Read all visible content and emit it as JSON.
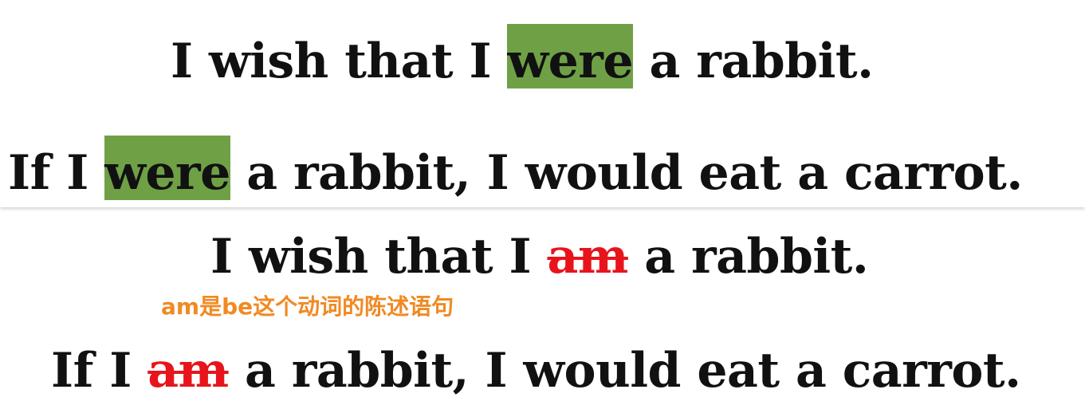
{
  "colors": {
    "highlight": "#6fa046",
    "strike": "#e8141c",
    "note": "#f08a24",
    "text": "#111111"
  },
  "top_panel": {
    "sentence1": {
      "before": "I wish that I ",
      "highlight": "were",
      "after": " a rabbit."
    },
    "sentence2": {
      "before": "If I ",
      "highlight": "were",
      "after": " a rabbit, I would eat a carrot."
    }
  },
  "bottom_panel": {
    "sentence1": {
      "before": "I wish that I ",
      "struck": "am",
      "after": " a rabbit."
    },
    "note": "am是be这个动词的陈述语句",
    "sentence2": {
      "before": "If I ",
      "struck": "am",
      "after": " a rabbit, I would eat a carrot."
    }
  }
}
